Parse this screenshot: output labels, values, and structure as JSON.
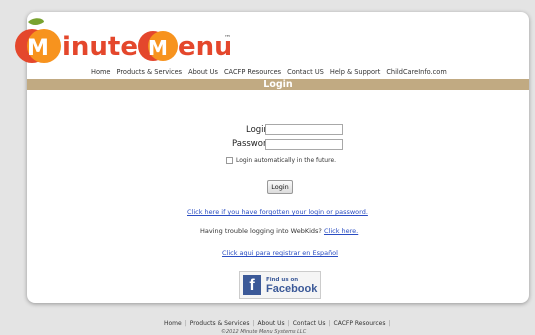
{
  "brand": {
    "logo_text": "Minute Menu",
    "colors": {
      "primary": "#e4472c",
      "accent": "#f7931e",
      "leaf": "#78a22f",
      "bar": "#c1aa82",
      "link": "#2a4dc2"
    }
  },
  "nav": {
    "items": [
      "Home",
      "Products & Services",
      "About Us",
      "CACFP Resources",
      "Contact US",
      "Help & Support",
      "ChildCareInfo.com"
    ]
  },
  "page": {
    "title": "Login"
  },
  "form": {
    "login_label": "Login:",
    "password_label": "Password:",
    "remember_label": "Login automatically in the future.",
    "submit_label": "Login"
  },
  "links": {
    "forgot": "Click here if you have forgotten your login or password.",
    "trouble_text": "Having trouble logging into WebKids?",
    "trouble_link": "Click here.",
    "espanol": "Click aqui para registrar en Español"
  },
  "facebook": {
    "find": "Find us on",
    "brand": "Facebook",
    "icon": "facebook-f-icon"
  },
  "footer": {
    "items": [
      "Home",
      "Products & Services",
      "About Us",
      "Contact Us",
      "CACFP Resources"
    ],
    "copyright": "©2012 Minute Menu Systems LLC"
  }
}
